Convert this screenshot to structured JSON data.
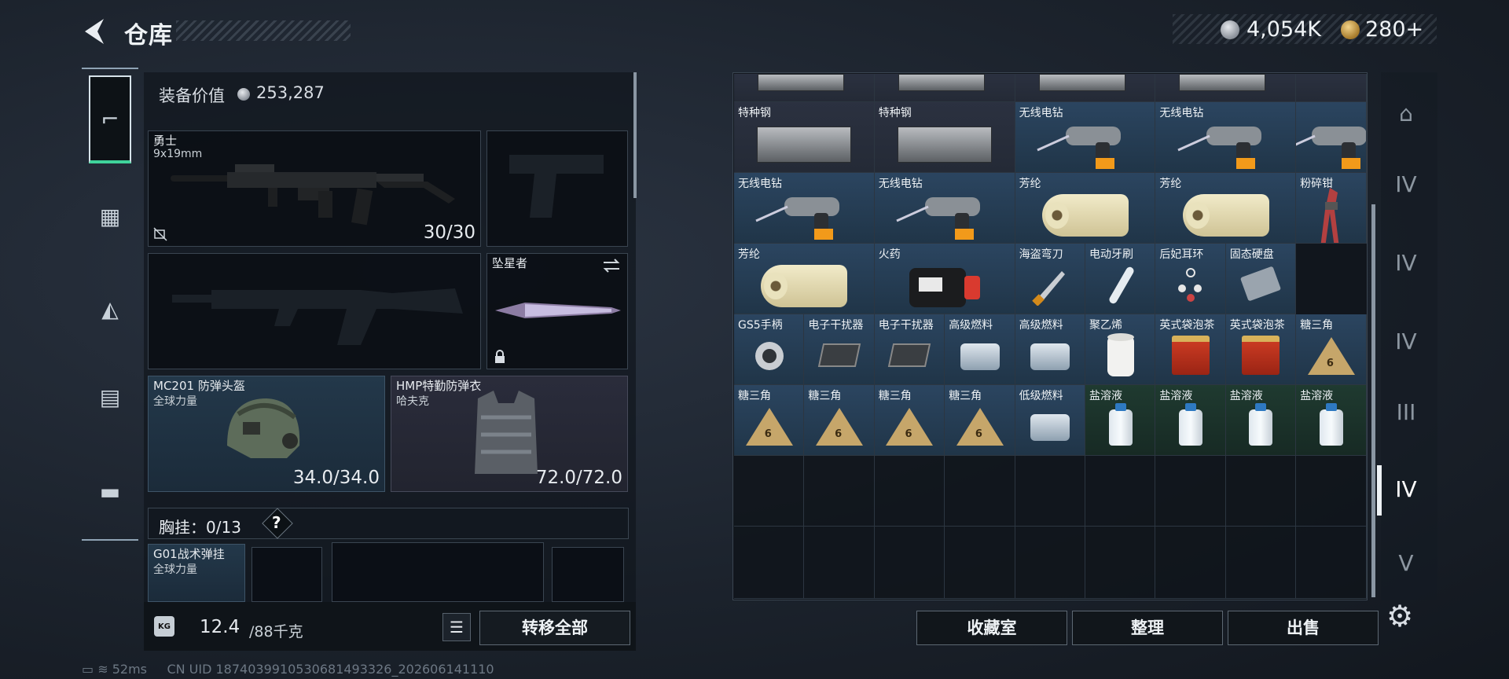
{
  "header": {
    "title": "仓库",
    "currency_silver": "4,054K",
    "currency_gold": "280+"
  },
  "equipment": {
    "value_label": "装备价值",
    "value": "253,287",
    "primary_weapon": {
      "name": "勇士",
      "ammo_type": "9x19mm",
      "ammo": "30/30"
    },
    "melee": {
      "name": "坠星者"
    },
    "helmet": {
      "name": "MC201 防弹头盔",
      "brand": "全球力量",
      "durability": "34.0/34.0"
    },
    "armor": {
      "name": "HMP特勤防弹衣",
      "brand": "哈夫克",
      "durability": "72.0/72.0"
    },
    "chest_rig": {
      "label": "胸挂：",
      "capacity": "0/13",
      "help": "?",
      "item_name": "G01战术弹挂",
      "item_brand": "全球力量"
    },
    "weight": {
      "current": "12.4",
      "suffix": "/88千克",
      "icon_text": "KG"
    },
    "transfer_all": "转移全部"
  },
  "stash": {
    "rows": [
      [
        {
          "name": "特种钢",
          "art": "steel",
          "color": "gray"
        },
        {
          "name": "特种钢",
          "art": "steel",
          "color": "gray"
        },
        {
          "name": "无线电钻",
          "art": "drill",
          "color": "blue"
        },
        {
          "name": "无线电钻",
          "art": "drill",
          "color": "blue"
        },
        {
          "name": "",
          "art": "drill-tall",
          "color": "blue"
        }
      ],
      [
        {
          "name": "无线电钻",
          "art": "drill",
          "color": "blue"
        },
        {
          "name": "无线电钻",
          "art": "drill",
          "color": "blue"
        },
        {
          "name": "芳纶",
          "art": "roll",
          "color": "blue"
        },
        {
          "name": "芳纶",
          "art": "roll",
          "color": "blue"
        },
        {
          "name": "粉碎钳",
          "art": "pliers",
          "color": "blue"
        }
      ],
      [
        {
          "name": "芳纶",
          "art": "roll",
          "color": "blue"
        },
        {
          "name": "火药",
          "art": "powder",
          "color": "blue"
        },
        {
          "name": "海盗弯刀",
          "art": "knife",
          "color": "blue"
        },
        {
          "name": "电动牙刷",
          "art": "toothbrush",
          "color": "blue"
        },
        {
          "name": "后妃耳环",
          "art": "earring",
          "color": "blue"
        },
        {
          "name": "固态硬盘",
          "art": "ssd",
          "color": "blue"
        }
      ],
      [
        {
          "name": "GS5手柄",
          "art": "grip",
          "color": "blue"
        },
        {
          "name": "电子干扰器",
          "art": "jammer",
          "color": "blue"
        },
        {
          "name": "电子干扰器",
          "art": "jammer",
          "color": "blue"
        },
        {
          "name": "高级燃料",
          "art": "can",
          "color": "blue"
        },
        {
          "name": "高级燃料",
          "art": "can",
          "color": "blue"
        },
        {
          "name": "聚乙烯",
          "art": "spool",
          "color": "blue"
        },
        {
          "name": "英式袋泡茶",
          "art": "tea",
          "color": "blue"
        },
        {
          "name": "英式袋泡茶",
          "art": "tea",
          "color": "blue"
        },
        {
          "name": "糖三角",
          "art": "tri",
          "color": "blue"
        }
      ],
      [
        {
          "name": "糖三角",
          "art": "tri",
          "color": "blue"
        },
        {
          "name": "糖三角",
          "art": "tri",
          "color": "blue"
        },
        {
          "name": "糖三角",
          "art": "tri",
          "color": "blue"
        },
        {
          "name": "糖三角",
          "art": "tri",
          "color": "blue"
        },
        {
          "name": "低级燃料",
          "art": "can",
          "color": "blue"
        },
        {
          "name": "盐溶液",
          "art": "bottle",
          "color": "green"
        },
        {
          "name": "盐溶液",
          "art": "bottle",
          "color": "green"
        },
        {
          "name": "盐溶液",
          "art": "bottle",
          "color": "green"
        },
        {
          "name": "盐溶液",
          "art": "bottle",
          "color": "green"
        }
      ]
    ]
  },
  "buttons": {
    "favorites": "收藏室",
    "organize": "整理",
    "sell": "出售"
  },
  "right_rail": {
    "labels": [
      "IV",
      "IV",
      "IV",
      "III",
      "IV",
      "V"
    ]
  },
  "status": {
    "ping": "52ms",
    "uid": "CN UID 1874039910530681493326_202606141110"
  }
}
